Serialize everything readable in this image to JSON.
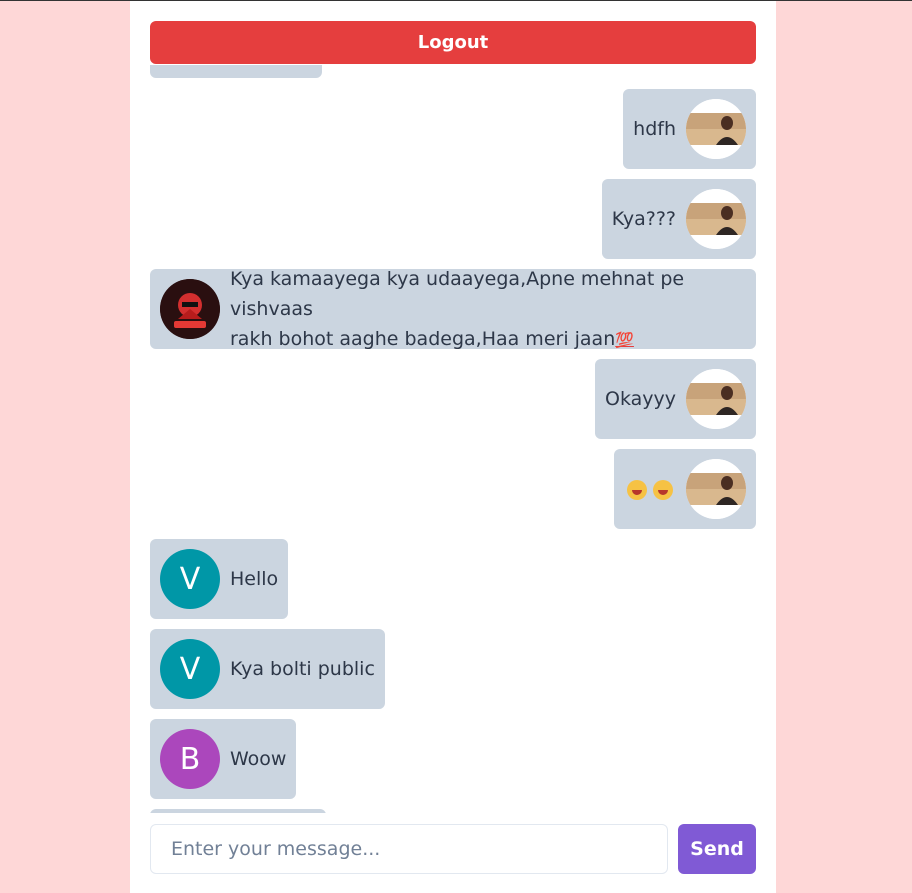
{
  "header": {
    "logout_label": "Logout"
  },
  "messages": [
    {
      "side": "right",
      "avatar": "user-photo",
      "text": "hdfh"
    },
    {
      "side": "right",
      "avatar": "user-photo",
      "text": "Kya???"
    },
    {
      "side": "left",
      "avatar": "gamer-logo",
      "line1": "Kya kamaayega kya udaayega,Apne mehnat pe vishvaas",
      "line2": "rakh bohot aaghe badega,Haa meri jaan",
      "emoji": "100-emoji"
    },
    {
      "side": "right",
      "avatar": "user-photo",
      "text": "Okayyy"
    },
    {
      "side": "right",
      "avatar": "user-photo",
      "emoji": "laughing-tears-emoji x2"
    },
    {
      "side": "left",
      "avatar_letter": "V",
      "avatar_color": "#0097a7",
      "text": "Hello"
    },
    {
      "side": "left",
      "avatar_letter": "V",
      "avatar_color": "#0097a7",
      "text": "Kya bolti public"
    },
    {
      "side": "left",
      "avatar_letter": "B",
      "avatar_color": "#ab47bc",
      "text": "Woow"
    }
  ],
  "composer": {
    "placeholder": "Enter your message...",
    "send_label": "Send"
  },
  "colors": {
    "page_bg": "#fed7d7",
    "logout": "#e53e3e",
    "bubble": "#cbd5e0",
    "send": "#805ad5"
  }
}
